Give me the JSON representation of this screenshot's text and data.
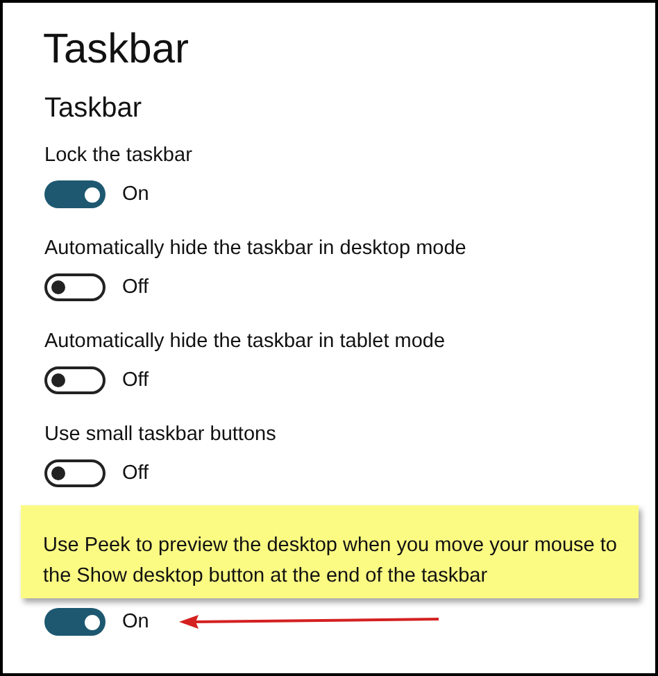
{
  "page": {
    "title": "Taskbar",
    "section": "Taskbar"
  },
  "settings": [
    {
      "label": "Lock the taskbar",
      "on": true,
      "state": "On"
    },
    {
      "label": "Automatically hide the taskbar in desktop mode",
      "on": false,
      "state": "Off"
    },
    {
      "label": "Automatically hide the taskbar in tablet mode",
      "on": false,
      "state": "Off"
    },
    {
      "label": "Use small taskbar buttons",
      "on": false,
      "state": "Off"
    },
    {
      "callout": "Use Peek to preview the desktop when you move your mouse to the Show desktop button at the end of the taskbar",
      "on": true,
      "state": "On",
      "arrow": true
    }
  ]
}
